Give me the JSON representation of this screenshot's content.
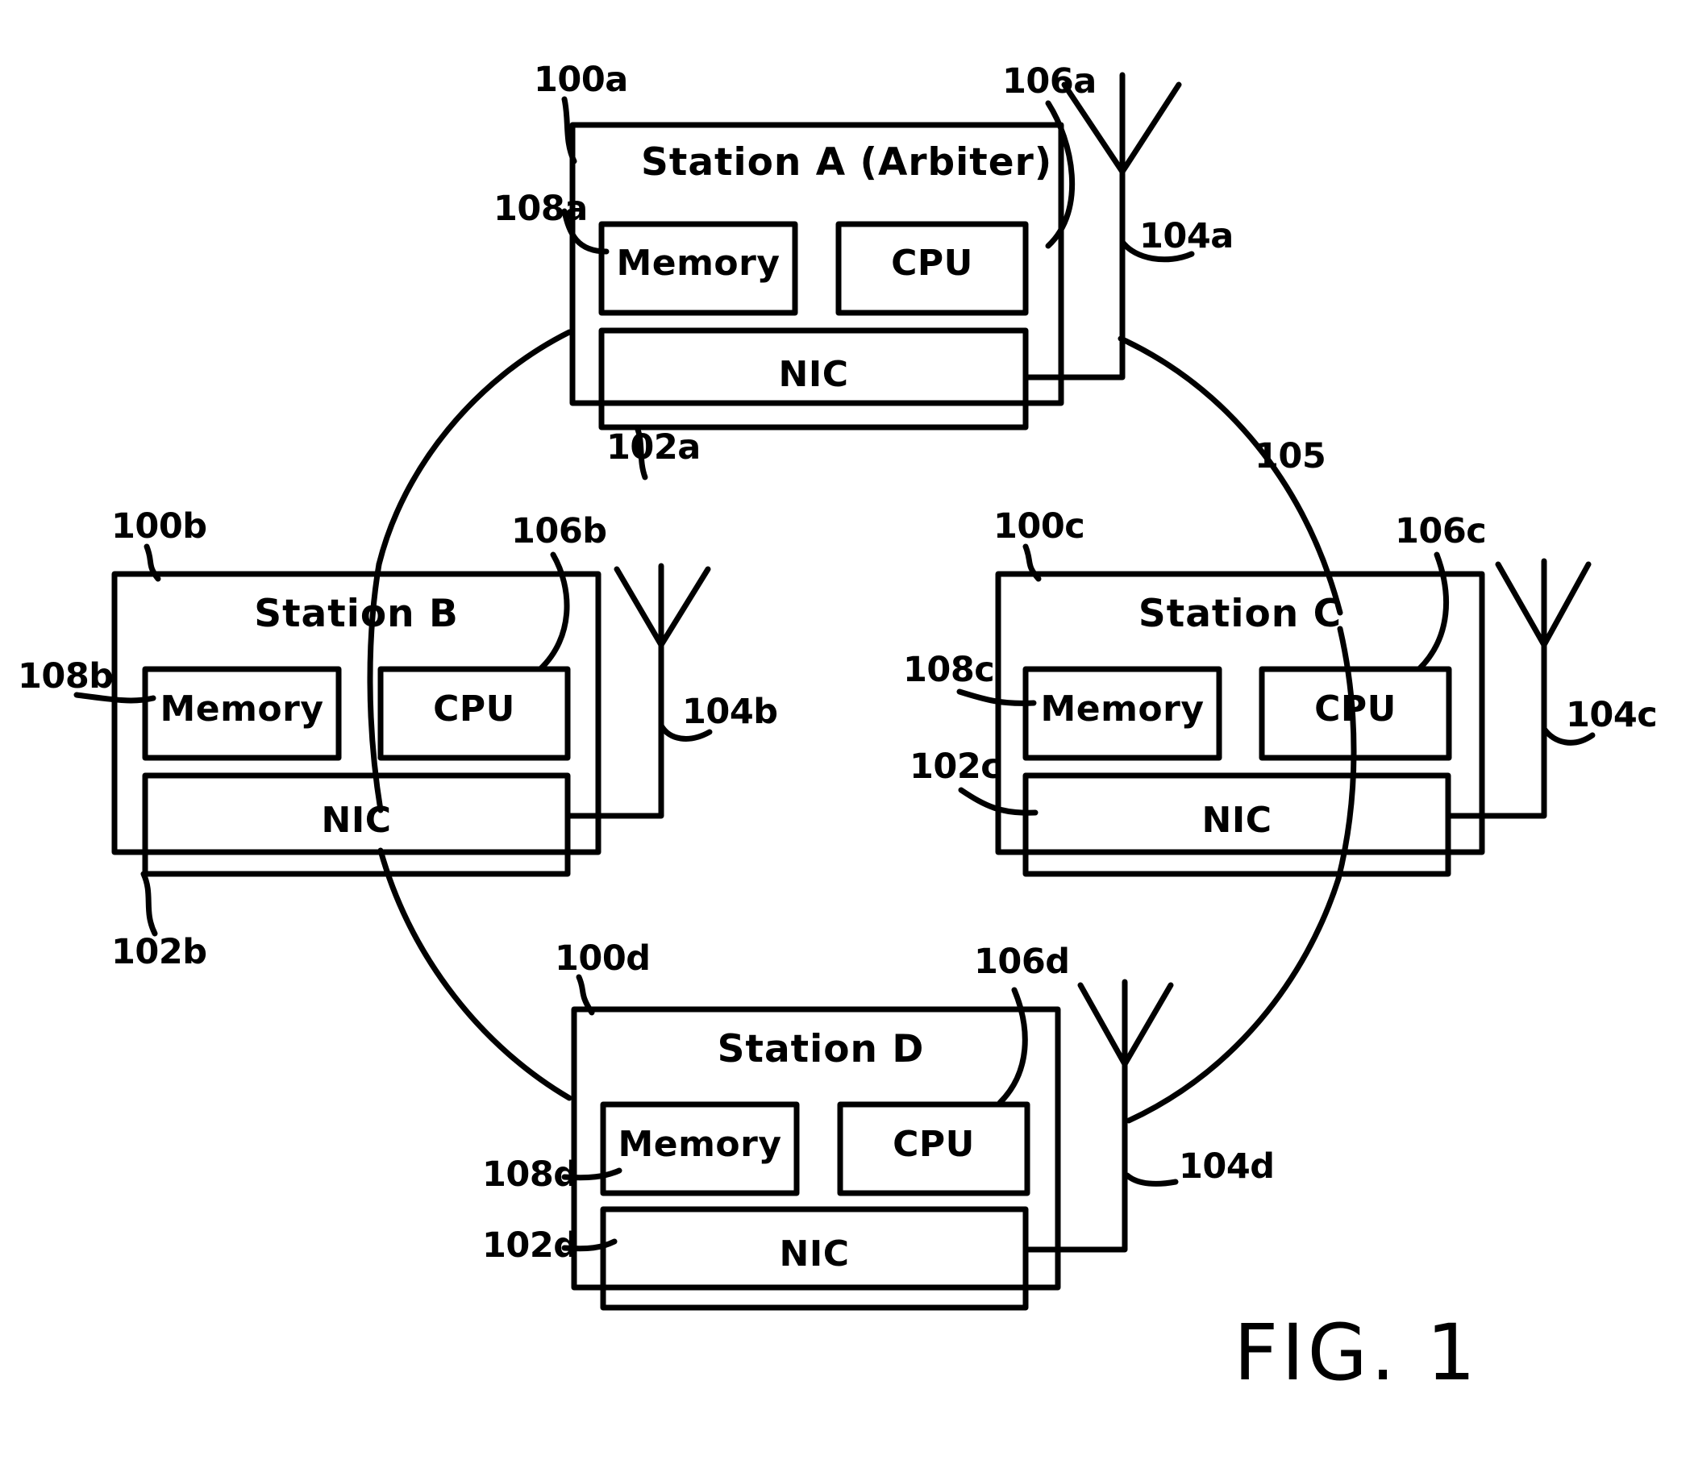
{
  "figure": {
    "caption": "FIG. 1",
    "network_ref": "105"
  },
  "stations": [
    {
      "id": "a",
      "title": "Station A  (Arbiter)",
      "station_ref": "100a",
      "nic_ref": "102a",
      "antenna_ref": "104a",
      "cpu_ref": "106a",
      "memory_ref": "108a",
      "memory_label": "Memory",
      "cpu_label": "CPU",
      "nic_label": "NIC"
    },
    {
      "id": "b",
      "title": "Station  B",
      "station_ref": "100b",
      "nic_ref": "102b",
      "antenna_ref": "104b",
      "cpu_ref": "106b",
      "memory_ref": "108b",
      "memory_label": "Memory",
      "cpu_label": "CPU",
      "nic_label": "NIC"
    },
    {
      "id": "c",
      "title": "Station  C",
      "station_ref": "100c",
      "nic_ref": "102c",
      "antenna_ref": "104c",
      "cpu_ref": "106c",
      "memory_ref": "108c",
      "memory_label": "Memory",
      "cpu_label": "CPU",
      "nic_label": "NIC"
    },
    {
      "id": "d",
      "title": "Station  D",
      "station_ref": "100d",
      "nic_ref": "102d",
      "antenna_ref": "104d",
      "cpu_ref": "106d",
      "memory_ref": "108d",
      "memory_label": "Memory",
      "cpu_label": "CPU",
      "nic_label": "NIC"
    }
  ],
  "colors": {
    "ink": "#000000",
    "paper": "#ffffff"
  }
}
